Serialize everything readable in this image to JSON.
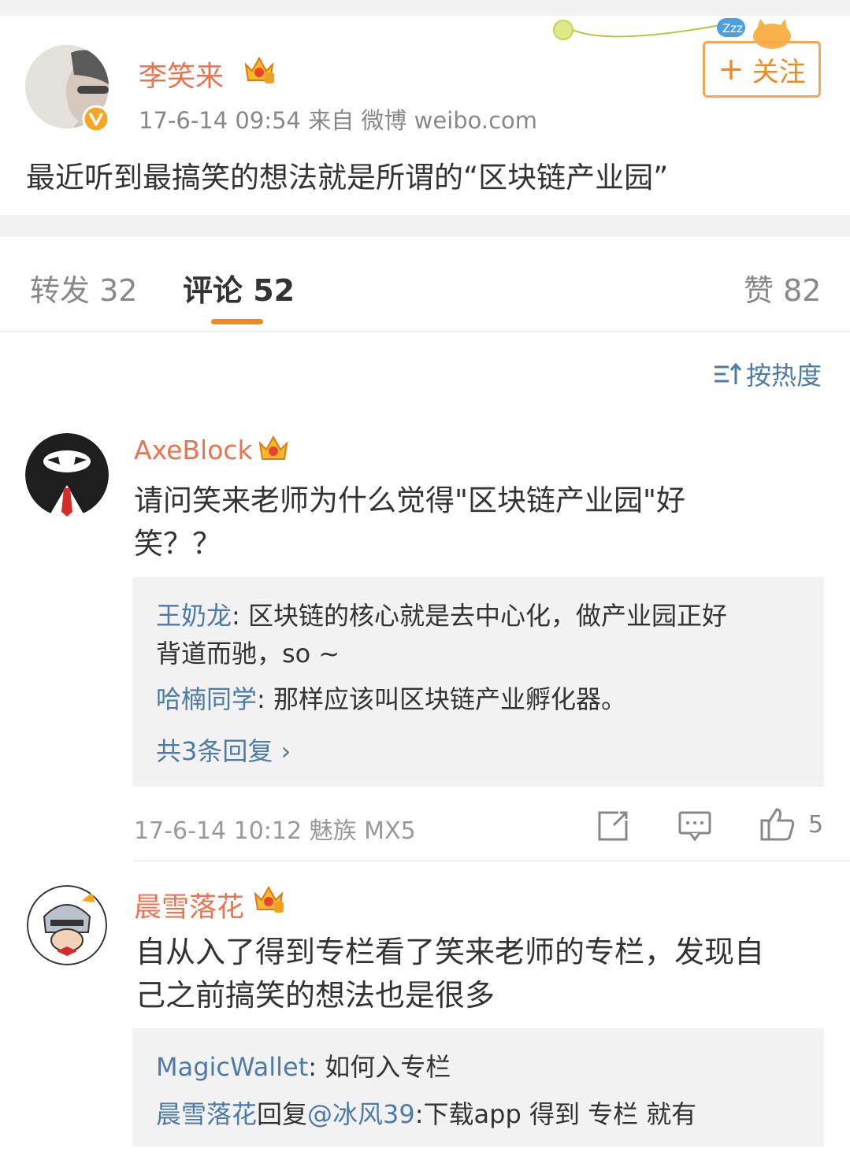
{
  "post": {
    "author": "李笑来",
    "meta": "17-6-14 09:54  来自 微博 weibo.com",
    "follow_label": "关注",
    "follow_plus": "+",
    "text": "最近听到最搞笑的想法就是所谓的“区块链产业园”"
  },
  "tabs": {
    "repost": "转发 32",
    "comments": "评论 52",
    "likes": "赞 82"
  },
  "sort_label": "按热度",
  "comments": [
    {
      "user": "AxeBlock",
      "text_line1": "请问笑来老师为什么觉得\"区块链产业园\"好",
      "text_line2": "笑？？",
      "replies": [
        {
          "name": "王奶龙",
          "text_line1": ": 区块链的核心就是去中心化，做产业园正好",
          "text_line2": "背道而驰，so ~"
        },
        {
          "name": "哈楠同学",
          "text_line1": ": 那样应该叫区块链产业孵化器。"
        }
      ],
      "more_replies": "共3条回复 ›",
      "meta": "17-6-14 10:12  魅族 MX5",
      "like_count": "5"
    },
    {
      "user": "晨雪落花",
      "text_line1": "自从入了得到专栏看了笑来老师的专栏，发现自",
      "text_line2": "己之前搞笑的想法也是很多",
      "replies": [
        {
          "name": "MagicWallet",
          "text_line1": ": 如何入专栏"
        },
        {
          "name": "晨雪落花",
          "reply_word": "回复",
          "mention": "@冰风39",
          "text_line1": ":下载app  得到  专栏  就有"
        }
      ]
    }
  ],
  "colors": {
    "username": "#eb7350",
    "link": "#4d7ba6",
    "accent": "#f08a20",
    "background_gray": "#f2f2f2"
  }
}
